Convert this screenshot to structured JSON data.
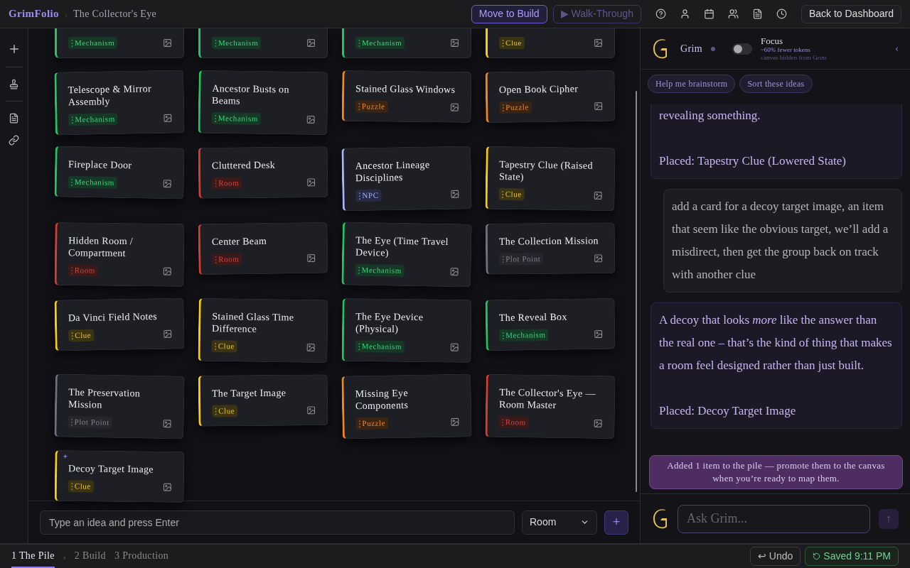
{
  "app": {
    "name": "GrimFolio",
    "separator": "›",
    "project": "The Collector's Eye"
  },
  "top_buttons": [
    {
      "label": "Move to Build",
      "kind": "primary"
    },
    {
      "label": "▶ Walk-Through",
      "kind": "muted"
    }
  ],
  "back_button": "Back to Dashboard",
  "cards": [
    {
      "kind": "mechanism",
      "tag": "Mechanism"
    },
    {
      "kind": "mechanism",
      "tag": "Mechanism"
    },
    {
      "kind": "mechanism",
      "tag": "Mechanism"
    },
    {
      "kind": "clue",
      "tag": "Clue"
    },
    {
      "title": "Telescope & Mirror Assembly",
      "kind": "mechanism",
      "tag": "Mechanism"
    },
    {
      "title": "Ancestor Busts on Beams",
      "kind": "mechanism",
      "tag": "Mechanism"
    },
    {
      "title": "Stained Glass Windows",
      "kind": "puzzle",
      "tag": "Puzzle"
    },
    {
      "title": "Open Book Cipher",
      "kind": "puzzle",
      "tag": "Puzzle"
    },
    {
      "title": "Fireplace Door",
      "kind": "mechanism",
      "tag": "Mechanism"
    },
    {
      "title": "Cluttered Desk",
      "kind": "room",
      "tag": "Room"
    },
    {
      "title": "Ancestor Lineage Disciplines",
      "kind": "npc",
      "tag": "NPC"
    },
    {
      "title": "Tapestry Clue (Raised State)",
      "kind": "clue",
      "tag": "Clue"
    },
    {
      "title": "Hidden Room / Compartment",
      "kind": "room",
      "tag": "Room"
    },
    {
      "title": "Center Beam",
      "kind": "room",
      "tag": "Room"
    },
    {
      "title": "The Eye (Time Travel Device)",
      "kind": "mechanism",
      "tag": "Mechanism"
    },
    {
      "title": "The Collection Mission",
      "kind": "plot",
      "tag": "Plot Point"
    },
    {
      "title": "Da Vinci Field Notes",
      "kind": "clue",
      "tag": "Clue"
    },
    {
      "title": "Stained Glass Time Difference",
      "kind": "clue",
      "tag": "Clue"
    },
    {
      "title": "The Eye Device (Physical)",
      "kind": "mechanism",
      "tag": "Mechanism"
    },
    {
      "title": "The Reveal Box",
      "kind": "mechanism",
      "tag": "Mechanism"
    },
    {
      "title": "The Preservation Mission",
      "kind": "plot",
      "tag": "Plot Point"
    },
    {
      "title": "The Target Image",
      "kind": "clue",
      "tag": "Clue"
    },
    {
      "title": "Missing Eye Components",
      "kind": "puzzle",
      "tag": "Puzzle"
    },
    {
      "title": "The Collector's Eye — Room Master",
      "kind": "room",
      "tag": "Room"
    },
    {
      "title": "Decoy Target Image",
      "kind": "clue",
      "tag": "Clue",
      "is_new": true
    }
  ],
  "composer": {
    "placeholder": "Type an idea and press Enter",
    "category": "Room",
    "add": "+"
  },
  "grim": {
    "name": "Grim",
    "focus": {
      "label": "Focus",
      "on": false,
      "note": "~60% fewer tokens",
      "sub": "canvas hidden from Grim"
    },
    "collapse": "‹"
  },
  "chips": [
    "Help me brainstorm",
    "Sort these ideas"
  ],
  "messages": [
    {
      "kind": "assistant",
      "paragraphs": [
        "revealing something.",
        "Placed: Tapestry Clue (Lowered State)"
      ]
    },
    {
      "kind": "user",
      "paragraphs": [
        "add a card for a decoy target image, an item that seem like the obvious target, we’ll add a misdirect, then get the group back on track with another clue"
      ]
    },
    {
      "kind": "assistant",
      "paragraphs": [
        "A decoy that looks *more* like the answer than the real one – that’s the kind of thing that makes a room feel designed rather than just built.",
        "Placed: Decoy Target Image"
      ]
    }
  ],
  "toast": "Added 1 item to the pile — promote them to the canvas when you’re ready to map them.",
  "ask": {
    "placeholder": "Ask Grim...",
    "send": "↑"
  },
  "steps": [
    {
      "number": "1",
      "label": "The Pile",
      "selected": true
    },
    {
      "number": "2",
      "label": "Build",
      "selected": false
    },
    {
      "number": "3",
      "label": "Production",
      "selected": false
    }
  ],
  "step_separator": "›",
  "undo": "↩ Undo",
  "saved": "Saved 9:11 PM"
}
